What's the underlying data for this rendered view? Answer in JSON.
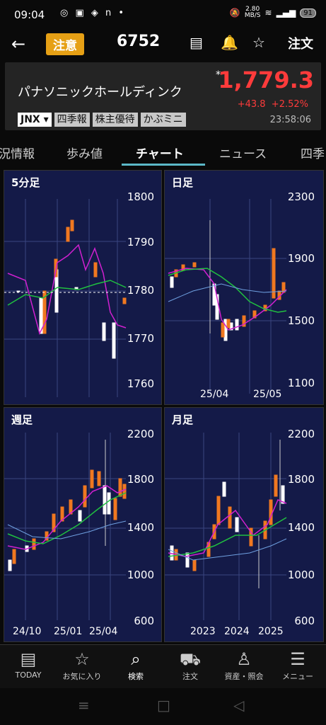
{
  "status": {
    "time": "09:04",
    "speed": "2.80\nMB/S",
    "battery": "91"
  },
  "header": {
    "badge": "注意",
    "code": "6752",
    "order": "注文"
  },
  "quote": {
    "name": "パナソニックホールディンク",
    "star": "*",
    "price": "1,779.3",
    "change": "+43.8",
    "pct": "+2.52%",
    "time": "23:58:06",
    "tags": [
      "JNX ▾",
      "四季報",
      "株主優待",
      "かぶミニ"
    ]
  },
  "tabs": [
    "況情報",
    "歩み値",
    "チャート",
    "ニュース",
    "四季"
  ],
  "panels": [
    {
      "title": "5分足",
      "ylabels": [
        "1800",
        "1790",
        "1780",
        "1770",
        "1760"
      ],
      "xlabels": []
    },
    {
      "title": "日足",
      "ylabels": [
        "2300",
        "1900",
        "1500",
        "1100"
      ],
      "xlabels": [
        "25/04",
        "25/05"
      ]
    },
    {
      "title": "週足",
      "ylabels": [
        "2200",
        "1800",
        "1400",
        "1000",
        "600"
      ],
      "xlabels": [
        "24/10",
        "25/01",
        "25/04"
      ]
    },
    {
      "title": "月足",
      "ylabels": [
        "2200",
        "1800",
        "1400",
        "1000",
        "600"
      ],
      "xlabels": [
        "2023",
        "2024",
        "2025"
      ]
    }
  ],
  "nav": [
    "TODAY",
    "お気に入り",
    "検索",
    "注文",
    "資産・照会",
    "メニュー"
  ],
  "colors": {
    "up": "#f07820",
    "down": "#ffffff",
    "bg": "#141a48",
    "accent": "#e6a015",
    "red": "#ff3b3b"
  }
}
